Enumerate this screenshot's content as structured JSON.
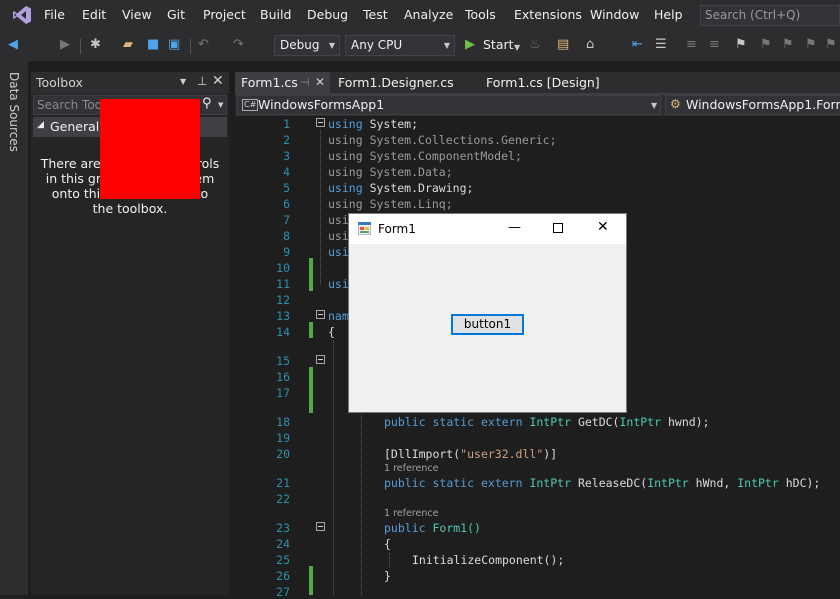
{
  "menu": [
    "File",
    "Edit",
    "View",
    "Git",
    "Project",
    "Build",
    "Debug",
    "Test",
    "Analyze",
    "Tools",
    "Extensions",
    "Window",
    "Help"
  ],
  "search": {
    "placeholder": "Search (Ctrl+Q)"
  },
  "toolbar": {
    "config": "Debug",
    "platform": "Any CPU",
    "start_label": "Start"
  },
  "side_strip": {
    "label": "Data Sources"
  },
  "toolbox": {
    "title": "Toolbox",
    "search_placeholder": "Search Toolbox",
    "group": "General",
    "message": "There are no usable controls in this group. Drag an item onto this text to add it to the toolbox."
  },
  "editor": {
    "tabs": [
      "Form1.cs",
      "Form1.Designer.cs",
      "Form1.cs [Design]"
    ],
    "nav_project": "WindowsFormsApp1",
    "nav_class": "WindowsFormsApp1.Form1",
    "line_numbers": [
      "1",
      "2",
      "3",
      "4",
      "5",
      "6",
      "7",
      "8",
      "9",
      "10",
      "11",
      "12",
      "13",
      "14",
      "15",
      "16",
      "17",
      "18",
      "19",
      "20",
      "21",
      "22",
      "23",
      "24",
      "25",
      "26",
      "27"
    ],
    "lines": {
      "l1": "System;",
      "l2": "System.Collections.Generic;",
      "l3": "System.ComponentModel;",
      "l4": "System.Data;",
      "l5": "System.Drawing;",
      "l6": "System.Linq;",
      "l7": "usi",
      "l8": "usi",
      "l9": "usi",
      "l11": "usi",
      "l13": "nam",
      "l14": "{",
      "l18_type": "IntPtr",
      "l18_method": "GetDC(",
      "l18_type2": "IntPtr",
      "l18_rest": "hwnd);",
      "l20_attr": "[DllImport(",
      "l20_str": "\"user32.dll\"",
      "l20_end": ")]",
      "ref1": "1 reference",
      "l21_type": "IntPtr",
      "l21_method": "ReleaseDC(",
      "l21_type2": "IntPtr",
      "l21_mid": "hWnd,",
      "l21_type3": "IntPtr",
      "l21_rest": "hDC);",
      "ref2": "1 reference",
      "l23_method": "Form1()",
      "l24": "{",
      "l25": "InitializeComponent();",
      "l26": "}",
      "kw_using": "using",
      "kw_public": "public",
      "kw_static": "static",
      "kw_extern": "extern"
    }
  },
  "form1": {
    "title": "Form1",
    "button_label": "button1"
  }
}
